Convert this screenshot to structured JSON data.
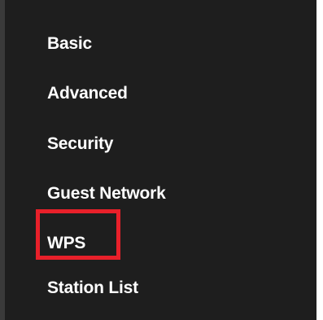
{
  "sidebar": {
    "items": [
      {
        "label": "Basic"
      },
      {
        "label": "Advanced"
      },
      {
        "label": "Security"
      },
      {
        "label": "Guest Network"
      },
      {
        "label": "WPS"
      },
      {
        "label": "Station List"
      }
    ]
  },
  "colors": {
    "sidebar_background": "#1e1e1e",
    "text": "#ffffff",
    "highlight_border": "#e8202a"
  }
}
